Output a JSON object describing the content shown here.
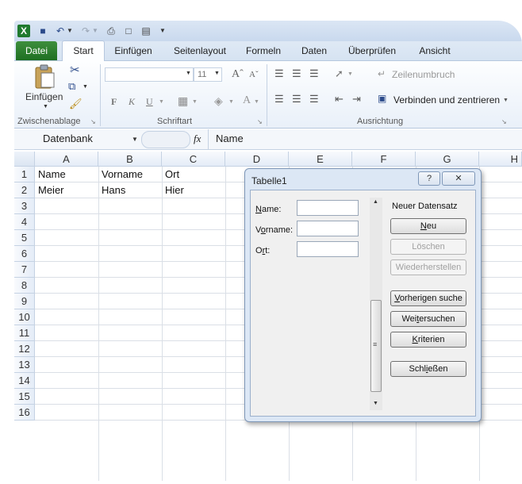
{
  "app": {
    "tabs": {
      "file": "Datei",
      "start": "Start",
      "insert": "Einfügen",
      "pagelayout": "Seitenlayout",
      "formulas": "Formeln",
      "data": "Daten",
      "review": "Überprüfen",
      "view": "Ansicht"
    },
    "ribbon": {
      "paste_label": "Einfügen",
      "font_size": "11",
      "wrap_text": "Zeilenumbruch",
      "merge_center": "Verbinden und zentrieren",
      "groups": {
        "clipboard": "Zwischenablage",
        "font": "Schriftart",
        "alignment": "Ausrichtung"
      },
      "format_buttons": {
        "bold": "F",
        "italic": "K",
        "underline": "U"
      }
    },
    "formula_bar": {
      "name_box": "Datenbank",
      "fx": "fx",
      "content": "Name"
    },
    "columns": [
      "A",
      "B",
      "C",
      "D",
      "E",
      "F",
      "G",
      "H"
    ],
    "rows": [
      "1",
      "2",
      "3",
      "4",
      "5",
      "6",
      "7",
      "8",
      "9",
      "10",
      "11",
      "12",
      "13",
      "14",
      "15",
      "16"
    ],
    "cells": {
      "A1": "Name",
      "B1": "Vorname",
      "C1": "Ort",
      "A2": "Meier",
      "B2": "Hans",
      "C2": "Hier"
    }
  },
  "dialog": {
    "title": "Tabelle1",
    "help_button": "?",
    "close_button": "✕",
    "fields": [
      {
        "label": "Name:",
        "value": ""
      },
      {
        "label": "Vorname:",
        "value": ""
      },
      {
        "label": "Ort:",
        "value": ""
      }
    ],
    "record_status": "Neuer Datensatz",
    "buttons": {
      "new": "Neu",
      "delete": "Löschen",
      "restore": "Wiederherstellen",
      "find_prev": "Vorherigen suche",
      "find_next": "Weitersuchen",
      "criteria": "Kriterien",
      "close": "Schließen"
    }
  }
}
